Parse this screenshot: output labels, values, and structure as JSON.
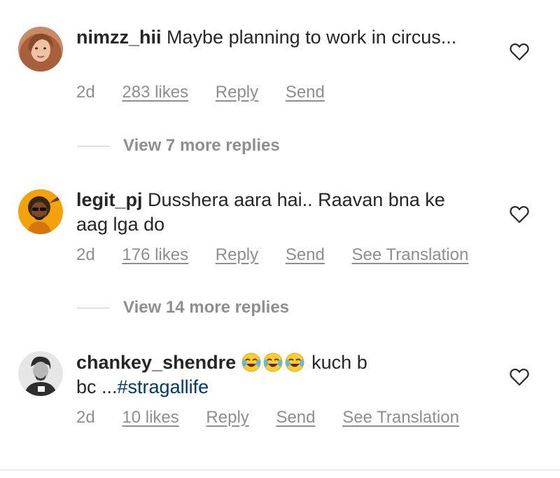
{
  "colors": {
    "text": "#262626",
    "meta": "#8e8e8e",
    "hashtag": "#00376b",
    "divider": "#c7c7c7"
  },
  "comments": [
    {
      "username": "nimzz_hii",
      "text": "Maybe planning to work in circus...",
      "time": "2d",
      "likes": "283 likes",
      "reply": "Reply",
      "send": "Send",
      "view_replies": "View 7 more replies",
      "icons": [
        "heart-outline-icon"
      ]
    },
    {
      "username": "legit_pj",
      "text": "Dusshera aara hai.. Raavan bna ke aag lga do",
      "time": "2d",
      "likes": "176 likes",
      "reply": "Reply",
      "send": "Send",
      "translate": "See Translation",
      "view_replies": "View 14 more replies",
      "icons": [
        "heart-outline-icon"
      ]
    },
    {
      "username": "chankey_shendre",
      "text_after_emoji": "kuch b",
      "text_line2": "bc ...",
      "hashtag": "#stragallife",
      "emoji": [
        "face-with-tears-of-joy",
        "face-with-tears-of-joy",
        "face-with-tears-of-joy"
      ],
      "time": "2d",
      "likes": "10 likes",
      "reply": "Reply",
      "send": "Send",
      "translate": "See Translation",
      "icons": [
        "heart-outline-icon"
      ]
    }
  ]
}
